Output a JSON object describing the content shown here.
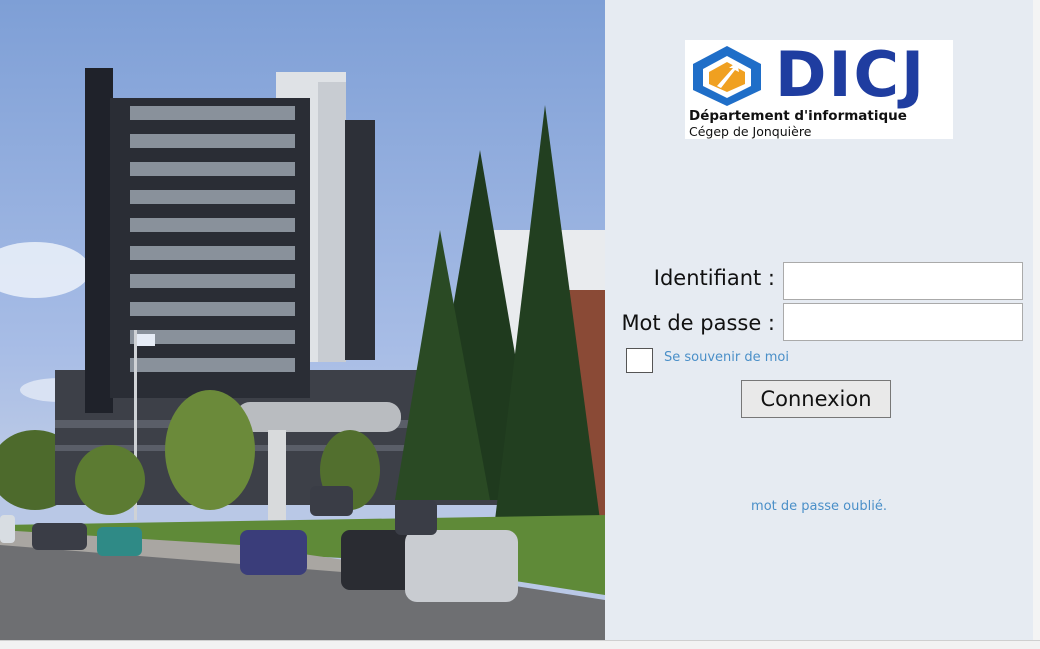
{
  "photo": {
    "description_icon": "campus-building-photo"
  },
  "logo": {
    "wordmark": "DICJ",
    "line1": "Département d'informatique",
    "line2": "Cégep de Jonquière"
  },
  "login": {
    "username_label": "Identifiant :",
    "username_value": "",
    "password_label": "Mot de passe :",
    "password_value": "",
    "remember_label": "Se souvenir de moi",
    "remember_checked": false,
    "submit_label": "Connexion",
    "forgot_label": "mot de passe oublié."
  },
  "colors": {
    "panel_bg": "#e6ebf2",
    "link": "#4a8fc8",
    "logo_blue": "#1f3da0",
    "logo_orange": "#f0a020"
  }
}
